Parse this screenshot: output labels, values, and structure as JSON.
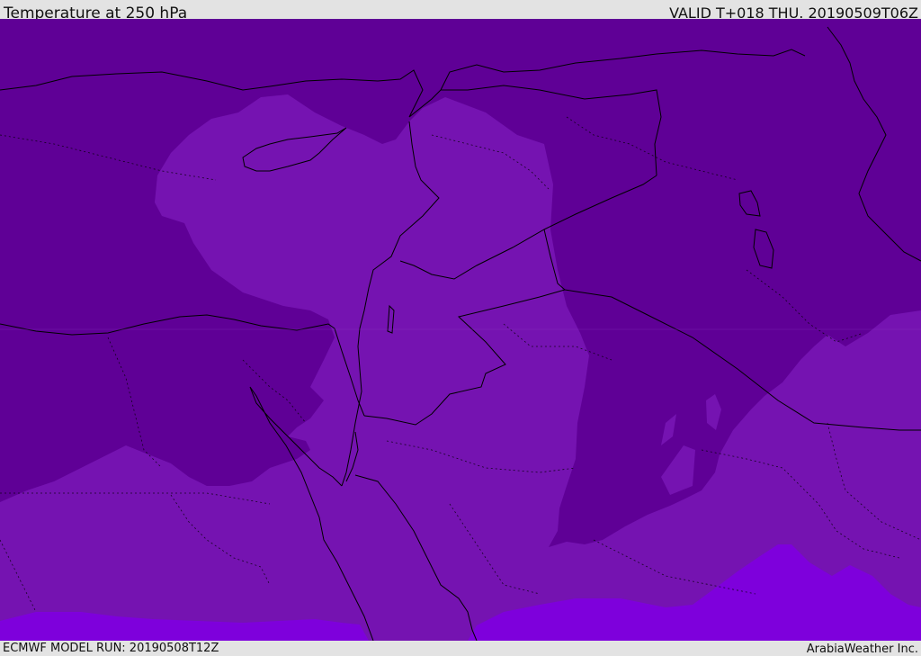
{
  "header": {
    "title": "Temperature at 250 hPa",
    "valid_time": "VALID T+018 THU. 20190509T06Z"
  },
  "footer": {
    "model_run": "ECMWF MODEL RUN: 20190508T12Z",
    "credit": "ArabiaWeather Inc."
  },
  "map": {
    "region": "Eastern Mediterranean / Levant / Egypt / Arabia",
    "variable": "temperature",
    "level": "250 hPa",
    "colors": {
      "colder_zone": "#5f0096",
      "mid_zone": "#7513b1",
      "warmer_zone": "#7e00dc",
      "boundary_lines": "#000000"
    }
  }
}
